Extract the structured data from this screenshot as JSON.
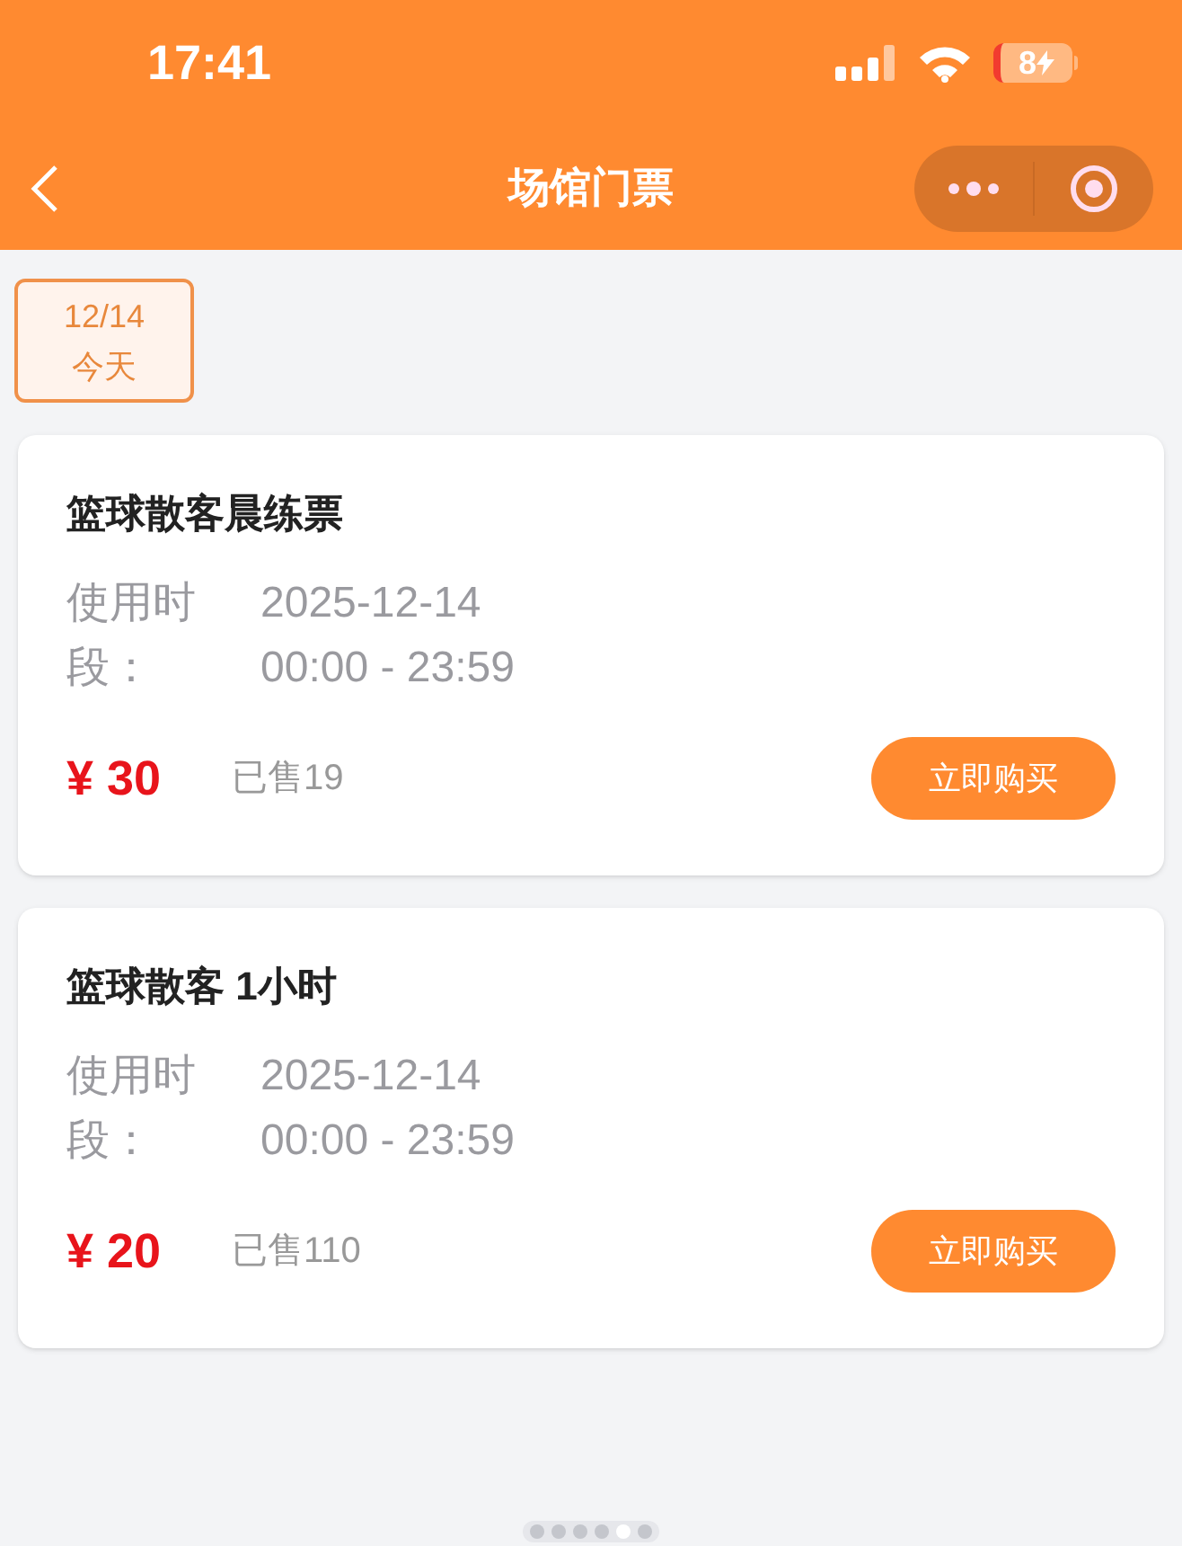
{
  "status_bar": {
    "time": "17:41",
    "battery": "8"
  },
  "nav": {
    "title": "场馆门票"
  },
  "date_tabs": [
    {
      "date": "12/14",
      "day": "今天",
      "selected": true
    }
  ],
  "tickets": [
    {
      "name": "篮球散客晨练票",
      "time_label": "使用时段：",
      "date": "2025-12-14",
      "hours": "00:00 - 23:59",
      "price": "¥ 30",
      "sold": "已售19",
      "button": "立即购买"
    },
    {
      "name": "篮球散客 1小时",
      "time_label": "使用时段：",
      "date": "2025-12-14",
      "hours": "00:00 - 23:59",
      "price": "¥ 20",
      "sold": "已售110",
      "button": "立即购买"
    }
  ],
  "page_dots": [
    {
      "selected": false
    },
    {
      "selected": false
    },
    {
      "selected": false
    },
    {
      "selected": false
    },
    {
      "selected": true
    },
    {
      "selected": false
    }
  ]
}
